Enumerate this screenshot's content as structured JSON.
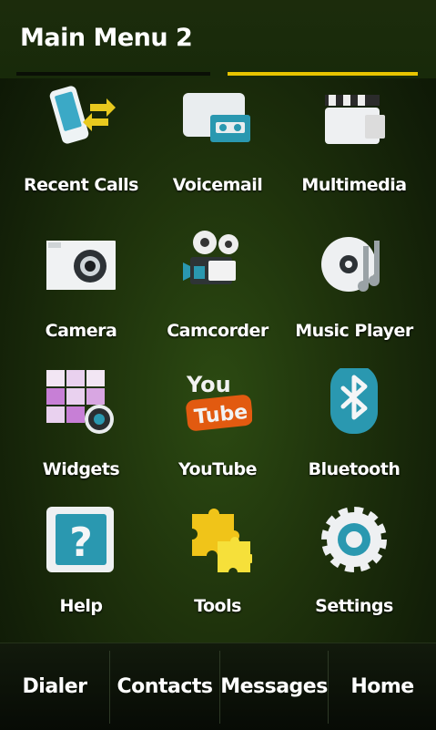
{
  "header": {
    "title": "Main Menu 2",
    "pages": 2,
    "current_page": 2
  },
  "apps": [
    {
      "label": "Recent Calls",
      "icon": "recent-calls-icon"
    },
    {
      "label": "Voicemail",
      "icon": "voicemail-icon"
    },
    {
      "label": "Multimedia",
      "icon": "multimedia-icon"
    },
    {
      "label": "Camera",
      "icon": "camera-icon"
    },
    {
      "label": "Camcorder",
      "icon": "camcorder-icon"
    },
    {
      "label": "Music Player",
      "icon": "music-player-icon"
    },
    {
      "label": "Widgets",
      "icon": "widgets-icon"
    },
    {
      "label": "YouTube",
      "icon": "youtube-icon"
    },
    {
      "label": "Bluetooth",
      "icon": "bluetooth-icon"
    },
    {
      "label": "Help",
      "icon": "help-icon"
    },
    {
      "label": "Tools",
      "icon": "tools-icon"
    },
    {
      "label": "Settings",
      "icon": "settings-icon"
    }
  ],
  "youtube_logo": {
    "top": "You",
    "bottom": "Tube"
  },
  "help_glyph": "?",
  "dock": [
    {
      "label": "Dialer"
    },
    {
      "label": "Contacts"
    },
    {
      "label": "Messages"
    },
    {
      "label": "Home"
    }
  ],
  "colors": {
    "accent": "#e7c400",
    "teal": "#2a98b0",
    "background": "#1f330c"
  }
}
